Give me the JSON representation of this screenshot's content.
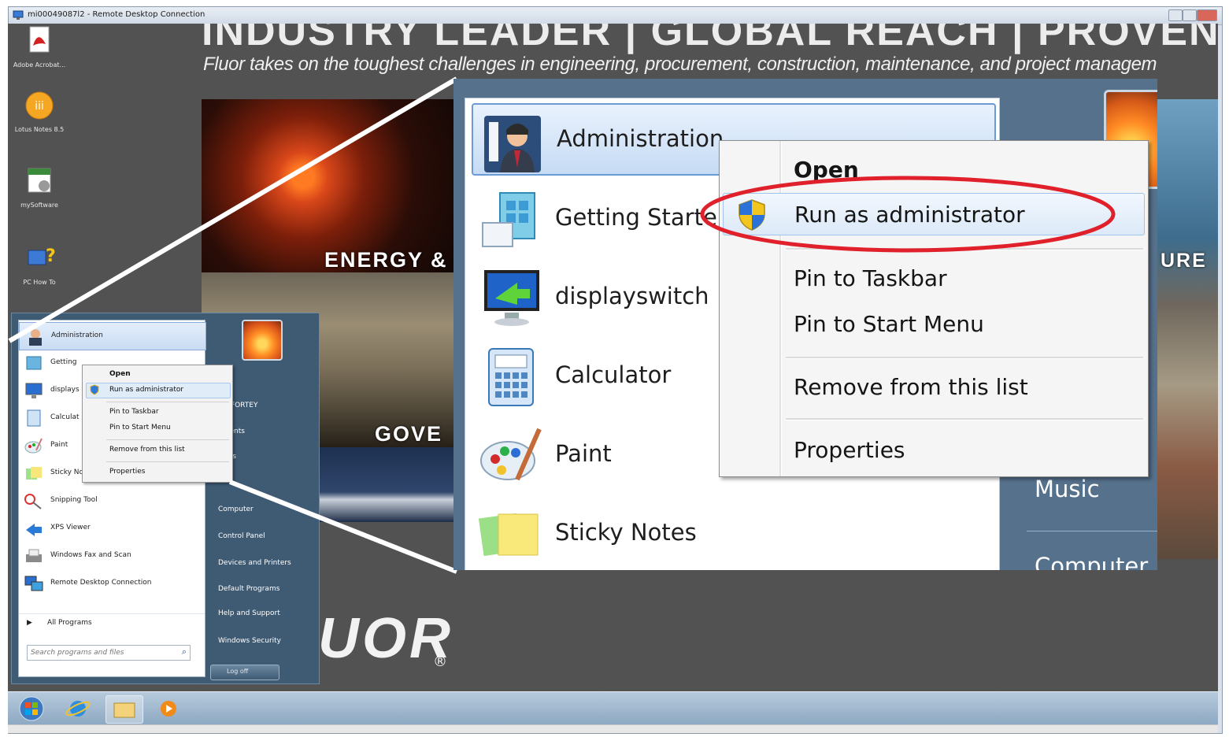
{
  "window": {
    "title": "mi00049087l2 - Remote Desktop Connection"
  },
  "banner": {
    "heading": "INDUSTRY LEADER  |  GLOBAL REACH  |  PROVEN EXPERTIS",
    "tagline": "Fluor takes on the toughest challenges in engineering, procurement, construction, maintenance, and project managem",
    "label_energy": "ENERGY &",
    "label_government": "GOVE",
    "label_infra": "URE",
    "logo": "UOR",
    "logo_mark": "®"
  },
  "desktop_icons": [
    {
      "label": "Adobe Acrobat...",
      "icon": "acrobat-icon"
    },
    {
      "label": "Lotus Notes 8.5",
      "icon": "lotus-notes-icon"
    },
    {
      "label": "mySoftware",
      "icon": "mysoftware-icon"
    },
    {
      "label": "PC How To",
      "icon": "pc-how-to-icon"
    }
  ],
  "small_start_menu": {
    "items": [
      {
        "label": "Administration"
      },
      {
        "label": "Getting"
      },
      {
        "label": "displays"
      },
      {
        "label": "Calculat"
      },
      {
        "label": "Paint"
      },
      {
        "label": "Sticky Notes"
      },
      {
        "label": "Snipping Tool"
      },
      {
        "label": "XPS Viewer"
      },
      {
        "label": "Windows Fax and Scan"
      },
      {
        "label": "Remote Desktop Connection"
      }
    ],
    "all_programs": "All Programs",
    "search_placeholder": "Search programs and files",
    "right_items": [
      "CH FORTEY",
      "uments",
      "tures",
      "Computer",
      "Control Panel",
      "Devices and Printers",
      "Default Programs",
      "Help and Support",
      "Windows Security"
    ],
    "shutdown": "Log off",
    "context_menu": {
      "open": "Open",
      "run_as_admin": "Run as administrator",
      "pin_taskbar": "Pin to Taskbar",
      "pin_start": "Pin to Start Menu",
      "remove": "Remove from this list",
      "properties": "Properties"
    }
  },
  "zoom_start_menu": {
    "items": [
      {
        "label": "Administration",
        "icon": "administration-icon"
      },
      {
        "label": "Getting Starte",
        "icon": "getting-started-icon"
      },
      {
        "label": "displayswitch",
        "icon": "displayswitch-icon"
      },
      {
        "label": "Calculator",
        "icon": "calculator-icon"
      },
      {
        "label": "Paint",
        "icon": "paint-icon"
      },
      {
        "label": "Sticky Notes",
        "icon": "sticky-notes-icon"
      }
    ],
    "right_music": "Music",
    "right_computer": "Computer"
  },
  "context_menu": {
    "open": "Open",
    "run_as_admin": "Run as administrator",
    "pin_taskbar": "Pin to Taskbar",
    "pin_start": "Pin to Start Menu",
    "remove": "Remove from this list",
    "properties": "Properties"
  },
  "colors": {
    "highlight_ellipse": "#e0202a",
    "menu_highlight": "#dce9f8",
    "desktop_bg": "#525252"
  }
}
